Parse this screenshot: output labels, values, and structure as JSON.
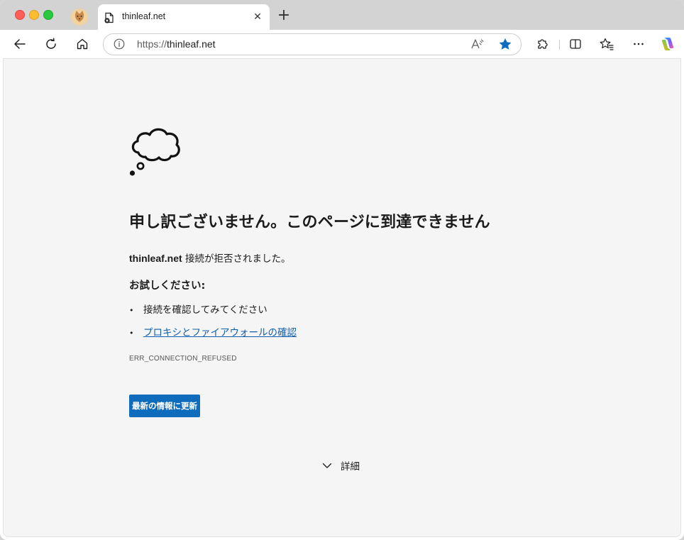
{
  "tab": {
    "title": "thinleaf.net",
    "close_glyph": "✕",
    "new_tab_glyph": "+"
  },
  "address_bar": {
    "protocol": "https://",
    "host": "thinleaf.net"
  },
  "icons": {
    "back": "back-arrow-icon",
    "refresh": "refresh-icon",
    "home": "home-icon",
    "info": "info-icon",
    "read_aloud": "read-aloud-icon",
    "favorite": "star-filled-icon",
    "extensions": "puzzle-icon",
    "split_screen": "split-screen-icon",
    "favorites": "favorites-icon",
    "more": "more-icon",
    "copilot": "copilot-icon",
    "error_illustration": "thought-cloud-icon"
  },
  "colors": {
    "accent": "#0f6cbd",
    "link": "#0f5fad",
    "star": "#0f6cbd"
  },
  "error_page": {
    "heading": "申し訳ございません。このページに到達できません",
    "host": "thinleaf.net",
    "message": "接続が拒否されました。",
    "try_heading": "お試しください:",
    "suggestions": [
      {
        "text": "接続を確認してみてください",
        "is_link": false
      },
      {
        "text": "プロキシとファイアウォールの確認",
        "is_link": true
      }
    ],
    "bullet_glyph": "•",
    "error_code": "ERR_CONNECTION_REFUSED",
    "refresh_button": "最新の情報に更新",
    "details_label": "詳細"
  }
}
